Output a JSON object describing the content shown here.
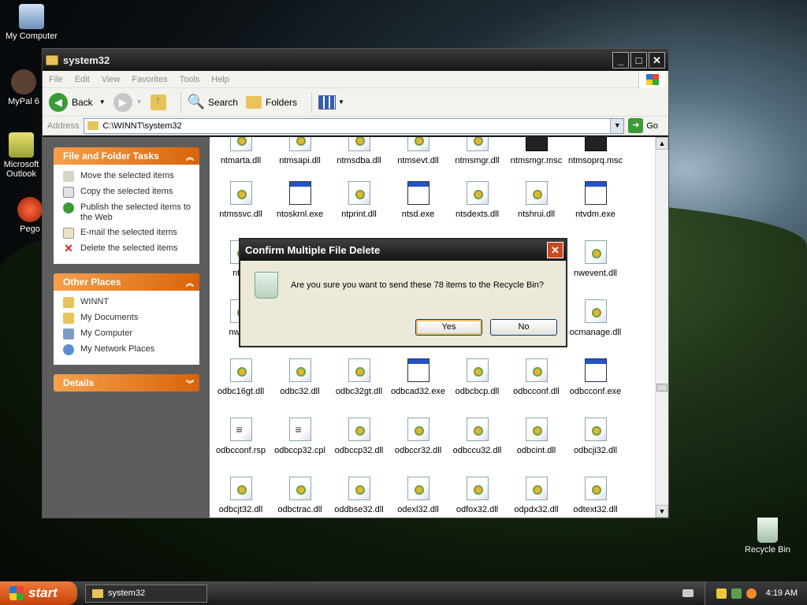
{
  "desktop": {
    "icons": [
      {
        "label": "My Computer",
        "icon": "my-computer-icon"
      },
      {
        "label": "MyPal 6",
        "icon": "mypal-icon"
      },
      {
        "label": "Microsoft Outlook",
        "icon": "outlook-icon"
      },
      {
        "label": "Pego",
        "icon": "pego-icon"
      },
      {
        "label": "Recycle Bin",
        "icon": "recycle-bin-icon"
      }
    ]
  },
  "window": {
    "title": "system32",
    "menu": [
      "File",
      "Edit",
      "View",
      "Favorites",
      "Tools",
      "Help"
    ],
    "toolbar": {
      "back": "Back",
      "search": "Search",
      "folders": "Folders"
    },
    "address": {
      "label": "Address",
      "value": "C:\\WINNT\\system32",
      "go": "Go"
    }
  },
  "leftpane": {
    "file_tasks": {
      "title": "File and Folder Tasks",
      "items": [
        "Move the selected items",
        "Copy the selected items",
        "Publish the selected items to the Web",
        "E-mail the selected items",
        "Delete the selected items"
      ]
    },
    "other_places": {
      "title": "Other Places",
      "items": [
        "WINNT",
        "My Documents",
        "My Computer",
        "My Network Places"
      ]
    },
    "details": {
      "title": "Details"
    }
  },
  "files": [
    [
      "ntmarta.dll",
      "ntmsapi.dll",
      "ntmsdba.dll",
      "ntmsevt.dll",
      "ntmsmgr.dll",
      "ntmsmgr.msc",
      "ntmsoprq.msc"
    ],
    [
      "ntmssvc.dll",
      "ntoskrnl.exe",
      "ntprint.dll",
      "ntsd.exe",
      "ntsdexts.dll",
      "ntshrui.dll",
      "ntvdm.exe"
    ],
    [
      "ntvd",
      "",
      "",
      "",
      "",
      "",
      "nwevent.dll"
    ],
    [
      "nwpro",
      "",
      "",
      "",
      "",
      "",
      "ocmanage.dll"
    ],
    [
      "odbc16gt.dll",
      "odbc32.dll",
      "odbc32gt.dll",
      "odbcad32.exe",
      "odbcbcp.dll",
      "odbcconf.dll",
      "odbcconf.exe"
    ],
    [
      "odbcconf.rsp",
      "odbccp32.cpl",
      "odbccp32.dll",
      "odbccr32.dll",
      "odbccu32.dll",
      "odbcint.dll",
      "odbcji32.dll"
    ],
    [
      "odbcjt32.dll",
      "odbctrac.dll",
      "oddbse32.dll",
      "odexl32.dll",
      "odfox32.dll",
      "odpdx32.dll",
      "odtext32.dll"
    ]
  ],
  "dialog": {
    "title": "Confirm Multiple File Delete",
    "message": "Are you sure you want to send these 78 items to the Recycle Bin?",
    "yes": "Yes",
    "no": "No"
  },
  "taskbar": {
    "start": "start",
    "task": "system32",
    "clock": "4:19 AM"
  }
}
